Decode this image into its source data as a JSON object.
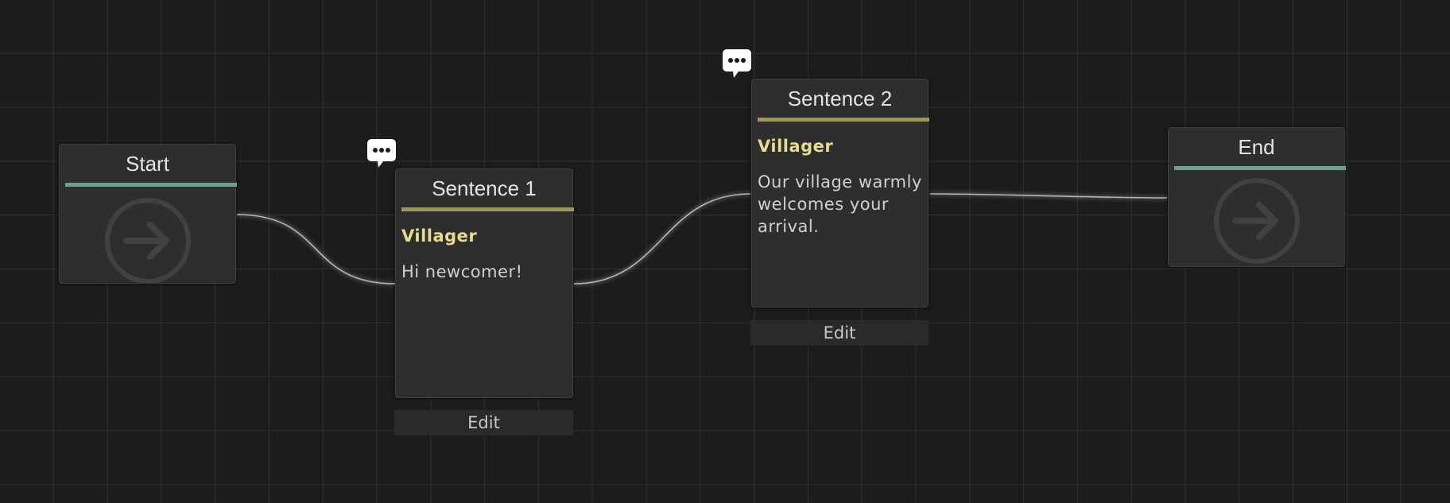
{
  "graph": {
    "start_node": {
      "title": "Start",
      "icon": "arrow-right-circle-icon"
    },
    "end_node": {
      "title": "End",
      "icon": "arrow-right-circle-icon"
    },
    "sentence_nodes": [
      {
        "title": "Sentence 1",
        "speaker": "Villager",
        "text": "Hi newcomer!",
        "edit_label": "Edit",
        "badge_icon": "speech-bubble-icon"
      },
      {
        "title": "Sentence 2",
        "speaker": "Villager",
        "text": "Our village warmly welcomes your arrival.",
        "edit_label": "Edit",
        "badge_icon": "speech-bubble-icon"
      }
    ]
  },
  "colors": {
    "background": "#1c1c1c",
    "grid_line": "#2f2f2f",
    "node_bg": "#2e2e2e",
    "terminal_accent": "#6ba08a",
    "sentence_accent": "#9f9558",
    "speaker_text": "#e8dc8c"
  }
}
